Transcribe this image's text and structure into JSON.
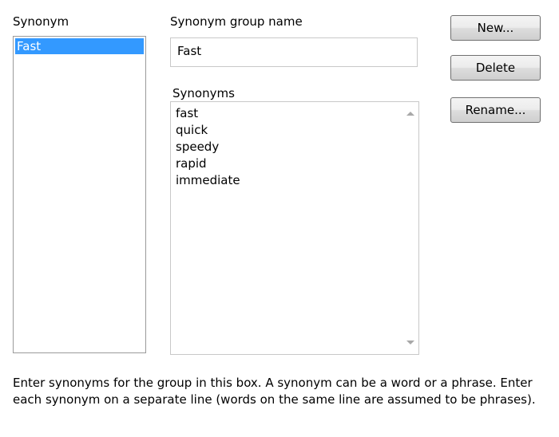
{
  "synonym_list": {
    "label": "Synonym",
    "items": [
      {
        "label": "Fast",
        "selected": true
      }
    ]
  },
  "group_name": {
    "label": "Synonym group name",
    "value": "Fast"
  },
  "synonyms": {
    "label": "Synonyms",
    "lines": [
      "fast",
      "quick",
      "speedy",
      "rapid",
      "immediate"
    ]
  },
  "buttons": {
    "new": "New...",
    "delete": "Delete",
    "rename": "Rename..."
  },
  "help_text": "Enter synonyms for the group in this box.  A synonym can be a word or a phrase. Enter each synonym on a separate line (words on the same line are assumed to be phrases).",
  "colors": {
    "selection": "#3399ff"
  }
}
